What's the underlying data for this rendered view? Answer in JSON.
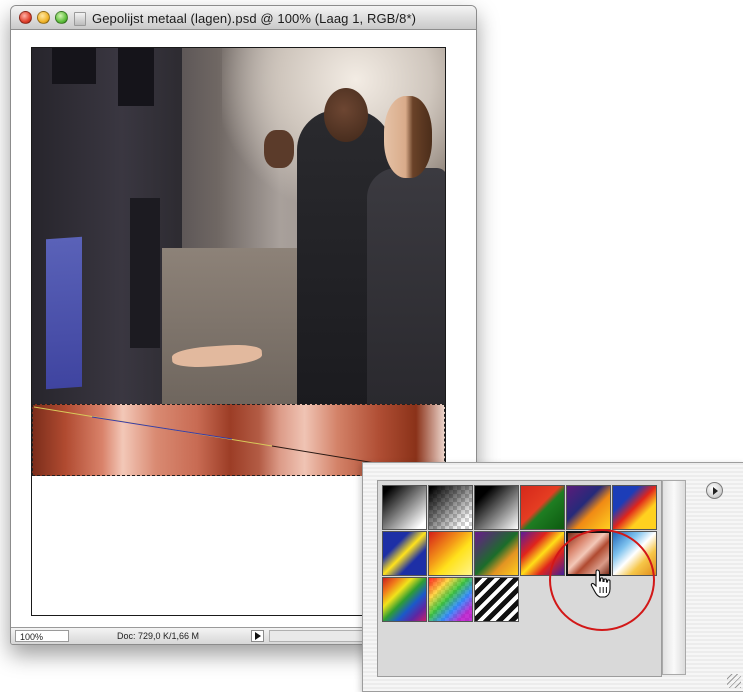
{
  "window": {
    "title": "Gepolijst metaal (lagen).psd @ 100% (Laag 1, RGB/8*)"
  },
  "statusbar": {
    "zoom": "100%",
    "doc_info": "Doc: 729,0 K/1,66 M"
  },
  "gradient_picker": {
    "presets": [
      {
        "icon": "black-white-gradient"
      },
      {
        "icon": "black-transparent-gradient"
      },
      {
        "icon": "black-white-gradient-2"
      },
      {
        "icon": "red-green-gradient"
      },
      {
        "icon": "violet-orange-gradient"
      },
      {
        "icon": "blue-red-yellow-gradient"
      },
      {
        "icon": "blue-yellow-blue-gradient"
      },
      {
        "icon": "orange-yellow-orange-gradient"
      },
      {
        "icon": "violet-green-orange-gradient"
      },
      {
        "icon": "yellow-violet-orange-blue-gradient"
      },
      {
        "icon": "copper-gradient",
        "selected": true
      },
      {
        "icon": "chrome-gradient"
      },
      {
        "icon": "spectrum-gradient"
      },
      {
        "icon": "transparent-rainbow-gradient"
      },
      {
        "icon": "transparent-stripes-gradient"
      }
    ]
  },
  "colors": {
    "highlight_circle": "#d21818"
  }
}
